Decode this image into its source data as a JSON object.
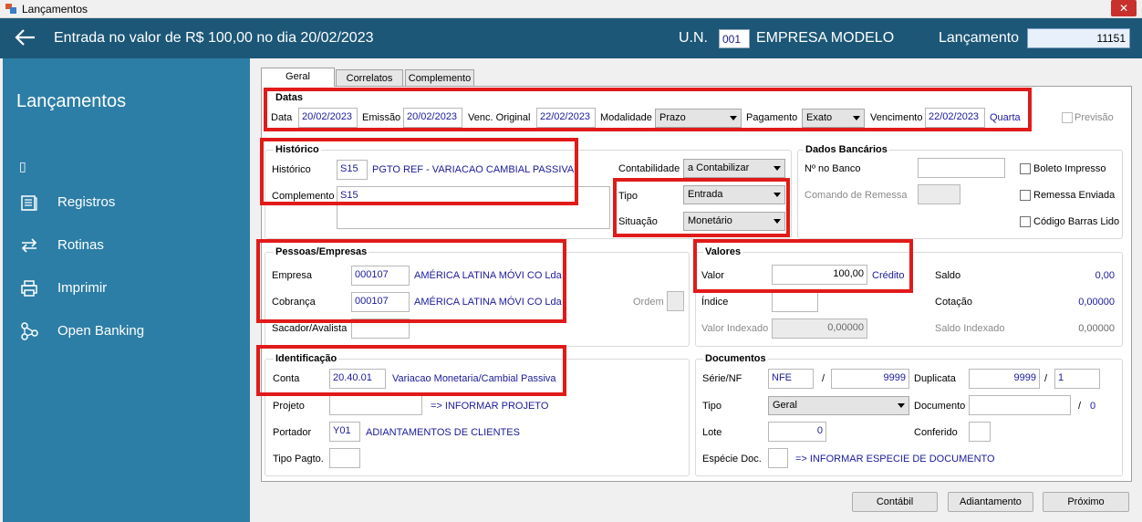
{
  "window": {
    "title": "Lançamentos",
    "close_label": "✕"
  },
  "header": {
    "back_icon": "arrow-left-icon",
    "title": "Entrada no valor de R$ 100,00 no dia 20/02/2023",
    "un_label": "U.N.",
    "un_value": "001",
    "empresa": "EMPRESA MODELO",
    "lancamento_label": "Lançamento",
    "lancamento_value": "11151"
  },
  "sidebar": {
    "title": "Lançamentos",
    "caret": "▯",
    "items": [
      {
        "label": "Registros",
        "icon": "ledger-icon"
      },
      {
        "label": "Rotinas",
        "icon": "exchange-icon"
      },
      {
        "label": "Imprimir",
        "icon": "printer-icon"
      },
      {
        "label": "Open Banking",
        "icon": "network-icon"
      }
    ]
  },
  "tabs": [
    "Geral",
    "Correlatos",
    "Complemento"
  ],
  "datas": {
    "title": "Datas",
    "data_label": "Data",
    "data_value": "20/02/2023",
    "emissao_label": "Emissão",
    "emissao_value": "20/02/2023",
    "venc_orig_label": "Venc. Original",
    "venc_orig_value": "22/02/2023",
    "modalidade_label": "Modalidade",
    "modalidade_value": "Prazo",
    "pagamento_label": "Pagamento",
    "pagamento_value": "Exato",
    "vencimento_label": "Vencimento",
    "vencimento_value": "22/02/2023",
    "dia_semana": "Quarta",
    "previsao_label": "Previsão"
  },
  "historico": {
    "title": "Histórico",
    "historico_label": "Histórico",
    "historico_code": "S15",
    "historico_desc": "PGTO REF - VARIACAO CAMBIAL PASSIVA",
    "complemento_label": "Complemento",
    "complemento_value": "S15",
    "contabilidade_label": "Contabilidade",
    "contabilidade_value": "a Contabilizar",
    "tipo_label": "Tipo",
    "tipo_value": "Entrada",
    "situacao_label": "Situação",
    "situacao_value": "Monetário"
  },
  "bancarios": {
    "title": "Dados Bancários",
    "nbanco_label": "Nº no Banco",
    "remessa_label": "Comando de Remessa",
    "boleto_label": "Boleto Impresso",
    "remessa_enviada_label": "Remessa Enviada",
    "codigo_barras_label": "Código Barras Lido"
  },
  "pessoas": {
    "title": "Pessoas/Empresas",
    "empresa_label": "Empresa",
    "empresa_code": "000107",
    "empresa_name": "AMÉRICA LATINA  MÓVI CO Lda",
    "cobranca_label": "Cobrança",
    "cobranca_code": "000107",
    "cobranca_name": "AMÉRICA LATINA  MÓVI CO Lda",
    "ordem_label": "Ordem",
    "sacador_label": "Sacador/Avalista"
  },
  "valores": {
    "title": "Valores",
    "valor_label": "Valor",
    "valor_value": "100,00",
    "valor_tipo": "Crédito",
    "saldo_label": "Saldo",
    "saldo_value": "0,00",
    "indice_label": "Índice",
    "cotacao_label": "Cotação",
    "cotacao_value": "0,00000",
    "valor_indexado_label": "Valor Indexado",
    "valor_indexado_value": "0,00000",
    "saldo_indexado_label": "Saldo Indexado",
    "saldo_indexado_value": "0,00000"
  },
  "identificacao": {
    "title": "Identificação",
    "conta_label": "Conta",
    "conta_code": "20.40.01",
    "conta_desc": "Variacao Monetaria/Cambial Passiva",
    "projeto_label": "Projeto",
    "projeto_hint": "=> INFORMAR PROJETO",
    "portador_label": "Portador",
    "portador_code": "Y01",
    "portador_desc": "ADIANTAMENTOS DE CLIENTES",
    "tipo_pagto_label": "Tipo Pagto."
  },
  "documentos": {
    "title": "Documentos",
    "serie_label": "Série/NF",
    "serie_value": "NFE",
    "slash": "/",
    "nf_value": "9999",
    "duplicata_label": "Duplicata",
    "duplicata_value": "9999",
    "duplicata_parcela": "1",
    "tipo_label": "Tipo",
    "tipo_value": "Geral",
    "documento_label": "Documento",
    "documento_extra": "0",
    "lote_label": "Lote",
    "lote_value": "0",
    "conferido_label": "Conferido",
    "especie_label": "Espécie Doc.",
    "especie_hint": "=> INFORMAR ESPECIE DE DOCUMENTO"
  },
  "footer": {
    "contabil_label": "Contábil",
    "adiantamento_label": "Adiantamento",
    "proximo_label": "Próximo"
  }
}
